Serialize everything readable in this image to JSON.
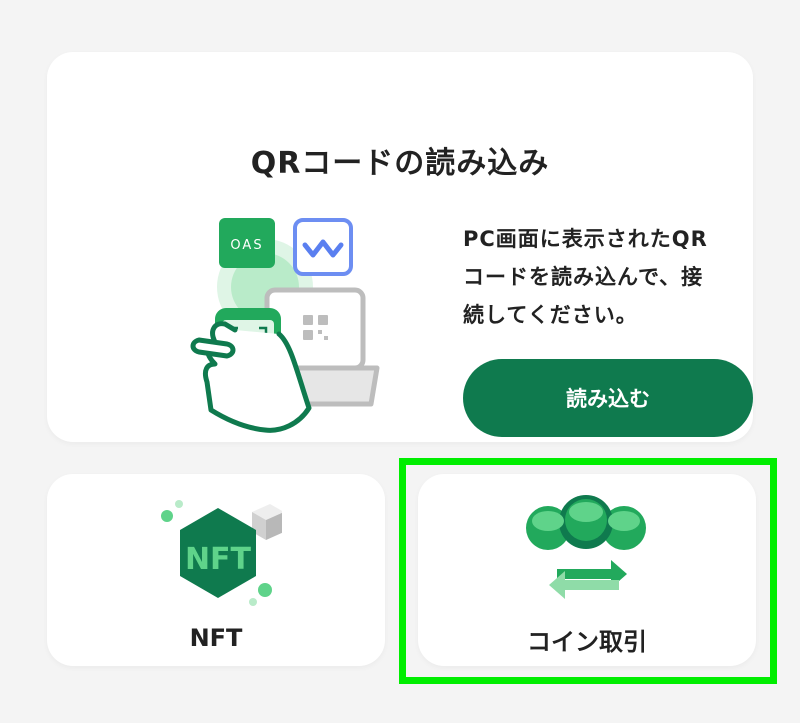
{
  "qr_card": {
    "title": "QRコードの読み込み",
    "description_lines": [
      "PC画面に表示されたQR",
      "コードを読み込んで、接",
      "続してください。"
    ],
    "button_label": "読み込む",
    "logos": {
      "oasys_logo_text": "OAS",
      "walletconnect_icon": "walletconnect-icon"
    }
  },
  "tiles": [
    {
      "label": "NFT",
      "icon": "nft-hexagon-icon",
      "hex_text": "NFT"
    },
    {
      "label": "コイン取引",
      "icon": "coin-exchange-icon"
    }
  ],
  "colors": {
    "background": "#f4f4f4",
    "card": "#ffffff",
    "primary": "#0f7a4e",
    "brand_green": "#22a95c",
    "light_green": "#5fd38a",
    "highlight": "#00ee00",
    "text": "#222222"
  },
  "highlight_target": "coin-trade-card"
}
